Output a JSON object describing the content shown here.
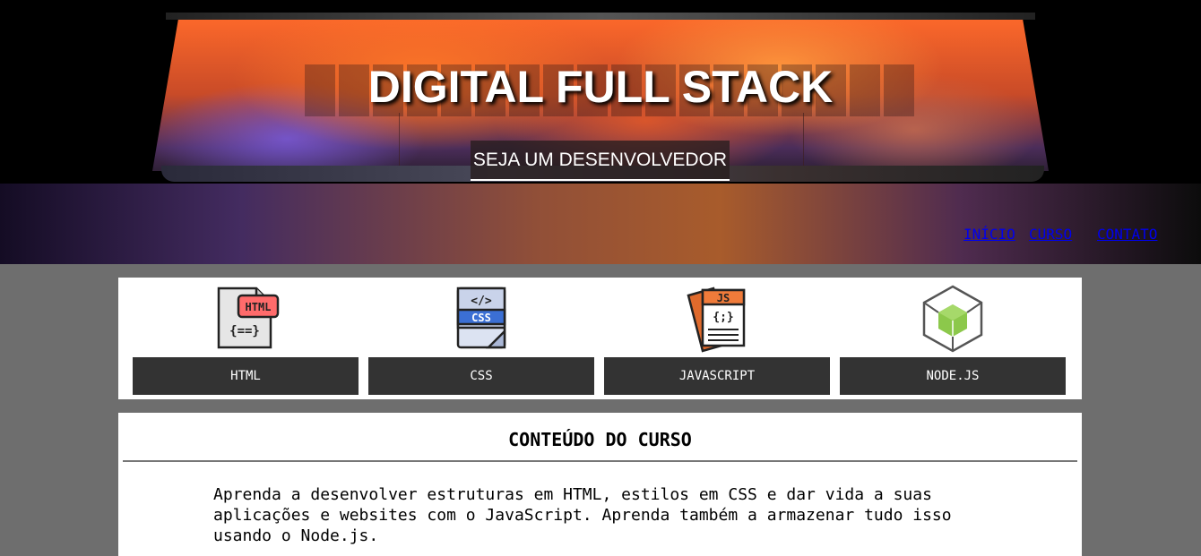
{
  "hero": {
    "title": "DIGITAL FULL STACK",
    "tagline": "SEJA UM DESENVOLVEDOR"
  },
  "nav": {
    "items": [
      {
        "label": "INÍCIO"
      },
      {
        "label": "CURSO"
      },
      {
        "label": "CONTATO"
      }
    ]
  },
  "technologies": [
    {
      "label": "HTML",
      "icon": "html-file-icon"
    },
    {
      "label": "CSS",
      "icon": "css-file-icon"
    },
    {
      "label": "JAVASCRIPT",
      "icon": "js-file-icon"
    },
    {
      "label": "NODE.JS",
      "icon": "nodejs-hexagon-icon"
    }
  ],
  "course": {
    "title": "CONTEÚDO DO CURSO",
    "description": "Aprenda a desenvolver estruturas em HTML, estilos em CSS e dar vida a suas aplicações e websites com o JavaScript. Aprenda também a armazenar tudo isso usando o Node.js."
  },
  "colors": {
    "page_background": "#6e6e6e",
    "panel_background": "#ffffff",
    "label_background": "#333333",
    "html_accent": "#ff6b6b",
    "css_accent": "#3b6fd4",
    "js_accent": "#f07b3a",
    "node_accent": "#8cc84b"
  }
}
